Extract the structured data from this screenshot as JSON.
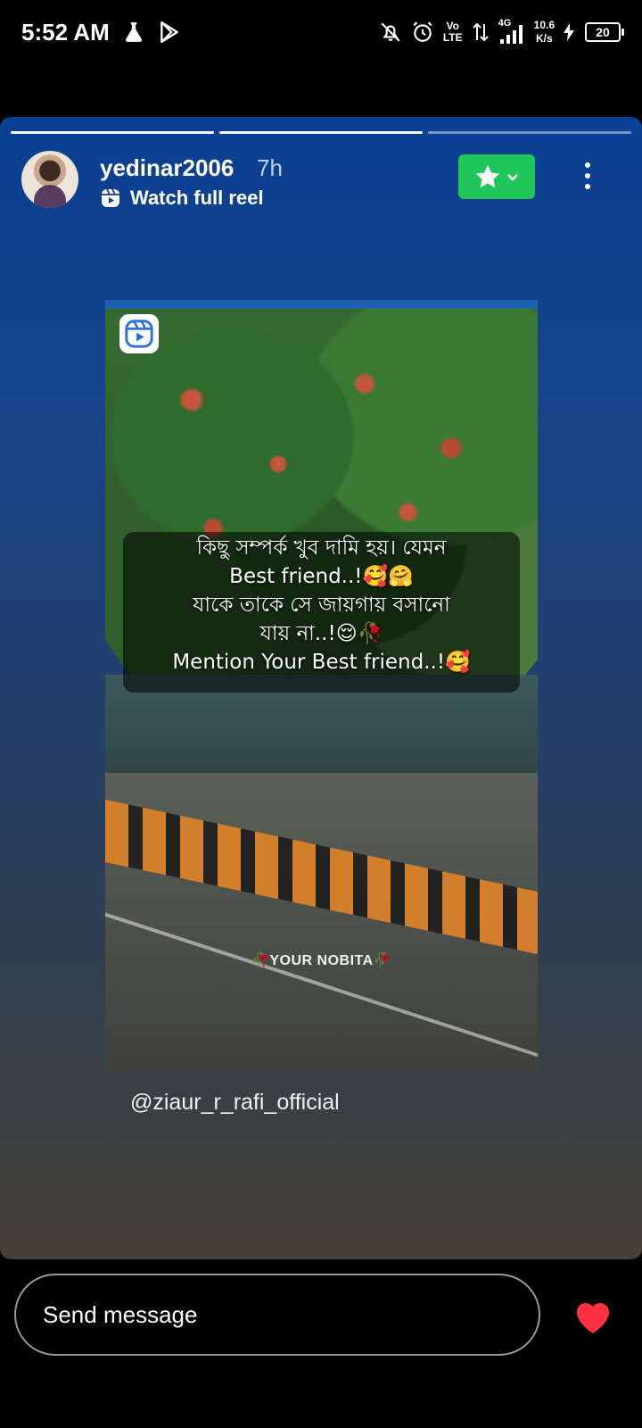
{
  "status_bar": {
    "time": "5:52 AM",
    "volte_top": "Vo",
    "volte_bottom": "LTE",
    "network": "4G",
    "speed_value": "10.6",
    "speed_unit": "K/s",
    "battery": "20"
  },
  "story": {
    "progress_segments": 3,
    "progress_done": 2,
    "username": "yedinar2006",
    "time_ago": "7h",
    "reel_link": "Watch full reel",
    "reel": {
      "caption_lines": [
        "কিছু সম্পর্ক খুব দামি হয়। যেমন",
        "Best friend..!🥰🤗",
        "যাকে তাকে সে জায়গায় বসানো",
        "যায় না..!😌🥀",
        "Mention Your Best friend..!🥰"
      ],
      "watermark": "🥀YOUR NOBITA🥀"
    },
    "mention": "@ziaur_r_rafi_official"
  },
  "footer": {
    "message_placeholder": "Send message"
  },
  "colors": {
    "favorite_green": "#1fc65a",
    "heart_red": "#ff3040"
  }
}
